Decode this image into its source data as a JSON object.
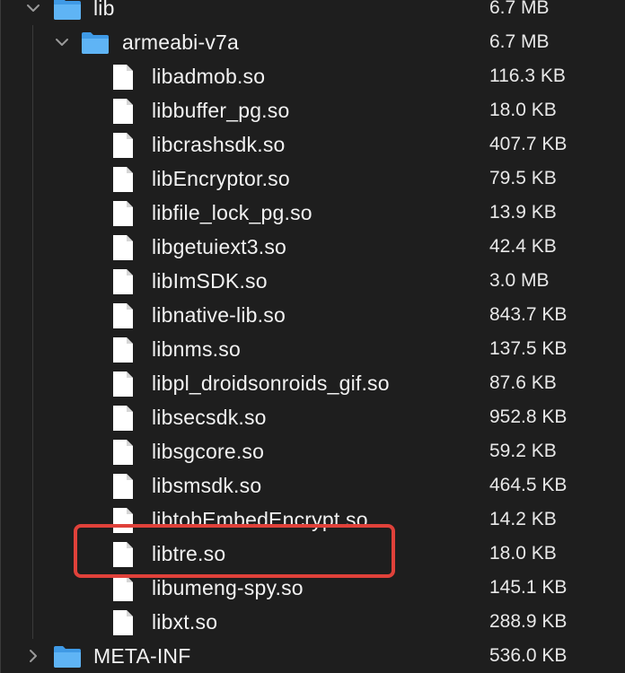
{
  "folders": {
    "lib": {
      "name": "lib",
      "size": "6.7 MB",
      "icon": "folder-icon",
      "expanded": true
    },
    "armeabi": {
      "name": "armeabi-v7a",
      "size": "6.7 MB",
      "icon": "folder-icon",
      "expanded": true
    },
    "meta_inf": {
      "name": "META-INF",
      "size": "536.0 KB",
      "icon": "folder-icon",
      "expanded": false
    }
  },
  "files": [
    {
      "name": "libadmob.so",
      "size": "116.3 KB"
    },
    {
      "name": "libbuffer_pg.so",
      "size": "18.0 KB"
    },
    {
      "name": "libcrashsdk.so",
      "size": "407.7 KB"
    },
    {
      "name": "libEncryptor.so",
      "size": "79.5 KB"
    },
    {
      "name": "libfile_lock_pg.so",
      "size": "13.9 KB"
    },
    {
      "name": "libgetuiext3.so",
      "size": "42.4 KB"
    },
    {
      "name": "libImSDK.so",
      "size": "3.0 MB"
    },
    {
      "name": "libnative-lib.so",
      "size": "843.7 KB"
    },
    {
      "name": "libnms.so",
      "size": "137.5 KB"
    },
    {
      "name": "libpl_droidsonroids_gif.so",
      "size": "87.6 KB"
    },
    {
      "name": "libsecsdk.so",
      "size": "952.8 KB"
    },
    {
      "name": "libsgcore.so",
      "size": "59.2 KB"
    },
    {
      "name": "libsmsdk.so",
      "size": "464.5 KB"
    },
    {
      "name": "libtobEmbedEncrypt.so",
      "size": "14.2 KB"
    },
    {
      "name": "libtre.so",
      "size": "18.0 KB",
      "highlighted": true
    },
    {
      "name": "libumeng-spy.so",
      "size": "145.1 KB"
    },
    {
      "name": "libxt.so",
      "size": "288.9 KB"
    }
  ],
  "colors": {
    "background": "#1e1e1e",
    "folder": "#4aa8f0",
    "file": "#ffffff",
    "highlight_border": "#e0413a"
  }
}
